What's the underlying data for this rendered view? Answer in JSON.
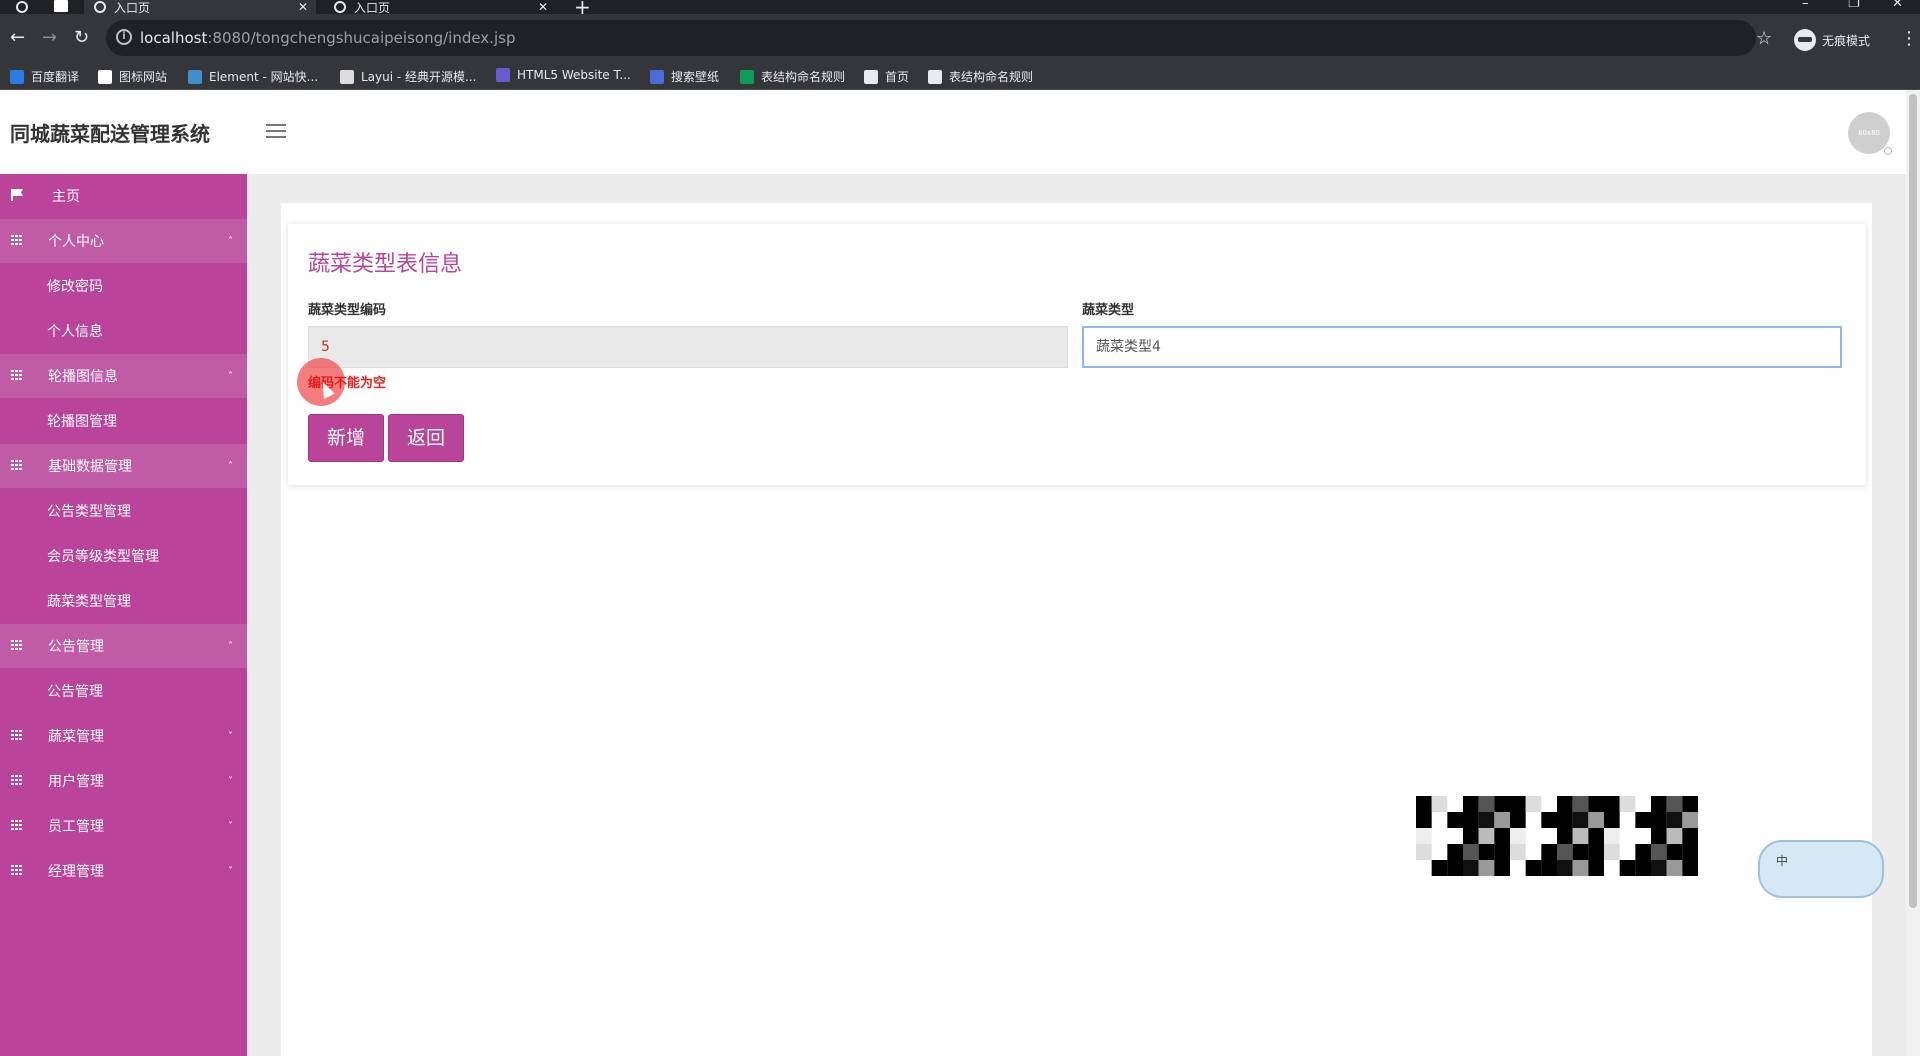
{
  "browser": {
    "tabs": [
      {
        "title": "入口页",
        "close": "✕"
      },
      {
        "title": "入口页",
        "close": "✕"
      }
    ],
    "new_tab": "+",
    "nav": {
      "back": "←",
      "forward": "→",
      "reload": "↻"
    },
    "url": {
      "host": "localhost",
      "path": ":8080/tongchengshucaipeisong/index.jsp"
    },
    "star": "☆",
    "incognito_label": "无痕模式",
    "menu": "⋮",
    "bookmarks": [
      {
        "label": "百度翻译",
        "color": "#2b7be4"
      },
      {
        "label": "图标网站",
        "color": "#ffffff"
      },
      {
        "label": "Element - 网站快...",
        "color": "#3e8ed0"
      },
      {
        "label": "Layui - 经典开源模...",
        "color": "#dddddd"
      },
      {
        "label": "HTML5 Website T...",
        "color": "#6a5acd"
      },
      {
        "label": "搜索壁纸",
        "color": "#4b6bd6"
      },
      {
        "label": "表结构命名规则",
        "color": "#0f9d58"
      },
      {
        "label": "首页",
        "color": "#e8eaed"
      },
      {
        "label": "表结构命名规则",
        "color": "#e8eaed"
      }
    ]
  },
  "header": {
    "title": "同城蔬菜配送管理系统",
    "avatar_text": "80x80"
  },
  "sidebar": {
    "items": [
      {
        "type": "top",
        "label": "主页"
      },
      {
        "type": "group",
        "label": "个人中心",
        "caret": "˄"
      },
      {
        "type": "sub",
        "label": "修改密码"
      },
      {
        "type": "sub",
        "label": "个人信息"
      },
      {
        "type": "group",
        "label": "轮播图信息",
        "caret": "˄"
      },
      {
        "type": "sub",
        "label": "轮播图管理"
      },
      {
        "type": "group",
        "label": "基础数据管理",
        "caret": "˄"
      },
      {
        "type": "sub",
        "label": "公告类型管理"
      },
      {
        "type": "sub",
        "label": "会员等级类型管理"
      },
      {
        "type": "sub",
        "label": "蔬菜类型管理"
      },
      {
        "type": "group",
        "label": "公告管理",
        "caret": "˄"
      },
      {
        "type": "sub",
        "label": "公告管理"
      },
      {
        "type": "collapsed",
        "label": "蔬菜管理",
        "caret": "˅"
      },
      {
        "type": "collapsed",
        "label": "用户管理",
        "caret": "˅"
      },
      {
        "type": "collapsed",
        "label": "员工管理",
        "caret": "˅"
      },
      {
        "type": "collapsed",
        "label": "经理管理",
        "caret": "˅"
      }
    ]
  },
  "form": {
    "title": "蔬菜类型表信息",
    "code_label": "蔬菜类型编码",
    "code_value": "5",
    "type_label": "蔬菜类型",
    "type_value": "蔬菜类型4",
    "error": "编码不能为空",
    "add_button": "新增",
    "back_button": "返回"
  },
  "widget": {
    "label": "中"
  },
  "colors": {
    "accent": "#b9449a",
    "error": "#e02020"
  }
}
